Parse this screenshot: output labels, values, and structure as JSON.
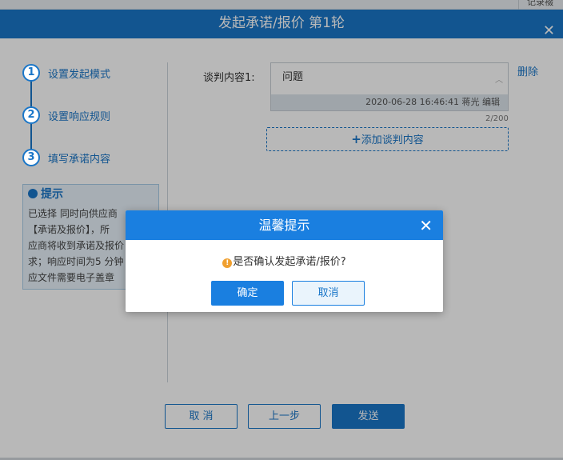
{
  "topstrip": {
    "corner_text": "记录裰"
  },
  "window": {
    "title": "发起承诺/报价 第1轮",
    "close_glyph": "✕"
  },
  "steps": [
    {
      "num": "1",
      "label": "设置发起模式"
    },
    {
      "num": "2",
      "label": "设置响应规则"
    },
    {
      "num": "3",
      "label": "填写承诺内容"
    }
  ],
  "hint": {
    "title": "提示",
    "lines": [
      "已选择 同时向供应商",
      "【承诺及报价】，所",
      "应商将收到承诺及报价",
      "求；响应时间为5 分钟",
      "应文件需要电子盖章"
    ]
  },
  "negotiation": {
    "label": "谈判内容1:",
    "content": "问题",
    "meta": "2020-06-28 16:46:41 蒋光 编辑",
    "delete_label": "删除",
    "counter": "2/200",
    "add_label": "添加谈判内容",
    "add_icon": "+"
  },
  "footer": {
    "cancel_label": "取 消",
    "prev_label": "上一步",
    "send_label": "发送"
  },
  "modal": {
    "title": "温馨提示",
    "close_glyph": "✕",
    "warn_glyph": "!",
    "message": "是否确认发起承诺/报价?",
    "ok_label": "确定",
    "cancel_label": "取消"
  },
  "colors": {
    "primary": "#1a76c8",
    "modal_header": "#1a7fe0",
    "hint_bg": "#e8f2fa",
    "warning": "#f0a030"
  }
}
